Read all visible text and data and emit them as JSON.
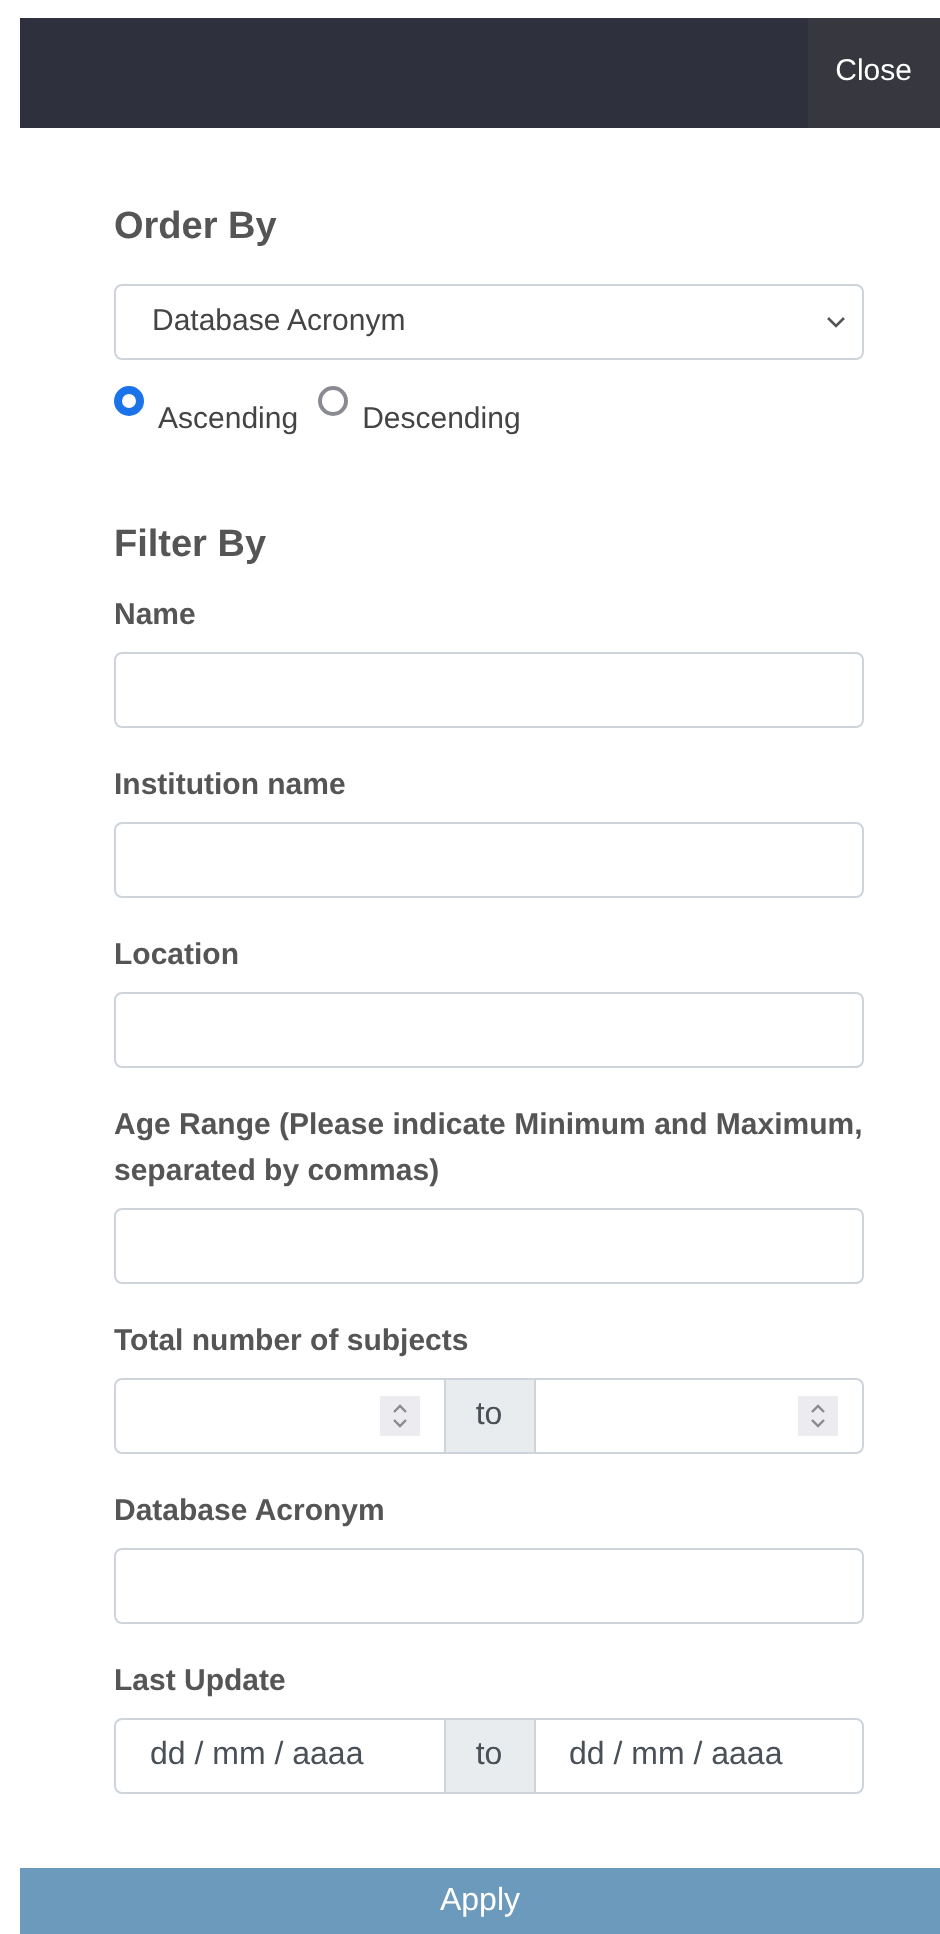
{
  "header": {
    "close_button": "Close"
  },
  "order_by": {
    "title": "Order By",
    "select_value": "Database Acronym",
    "directions": [
      {
        "label": "Ascending",
        "selected": true
      },
      {
        "label": "Descending",
        "selected": false
      }
    ]
  },
  "filter_by": {
    "title": "Filter By",
    "fields": [
      {
        "kind": "text",
        "label": "Name"
      },
      {
        "kind": "text",
        "label": "Institution name"
      },
      {
        "kind": "text",
        "label": "Location"
      },
      {
        "kind": "text",
        "label": "Age Range (Please indicate Minimum and Maximum, separated by commas)"
      },
      {
        "kind": "number_range",
        "label": "Total number of subjects",
        "separator": "to"
      },
      {
        "kind": "text",
        "label": "Database Acronym"
      },
      {
        "kind": "date_range",
        "label": "Last Update",
        "separator": "to",
        "from_placeholder": "dd / mm / aaaa",
        "to_placeholder": "dd / mm / aaaa"
      }
    ]
  },
  "apply_button": "Apply"
}
